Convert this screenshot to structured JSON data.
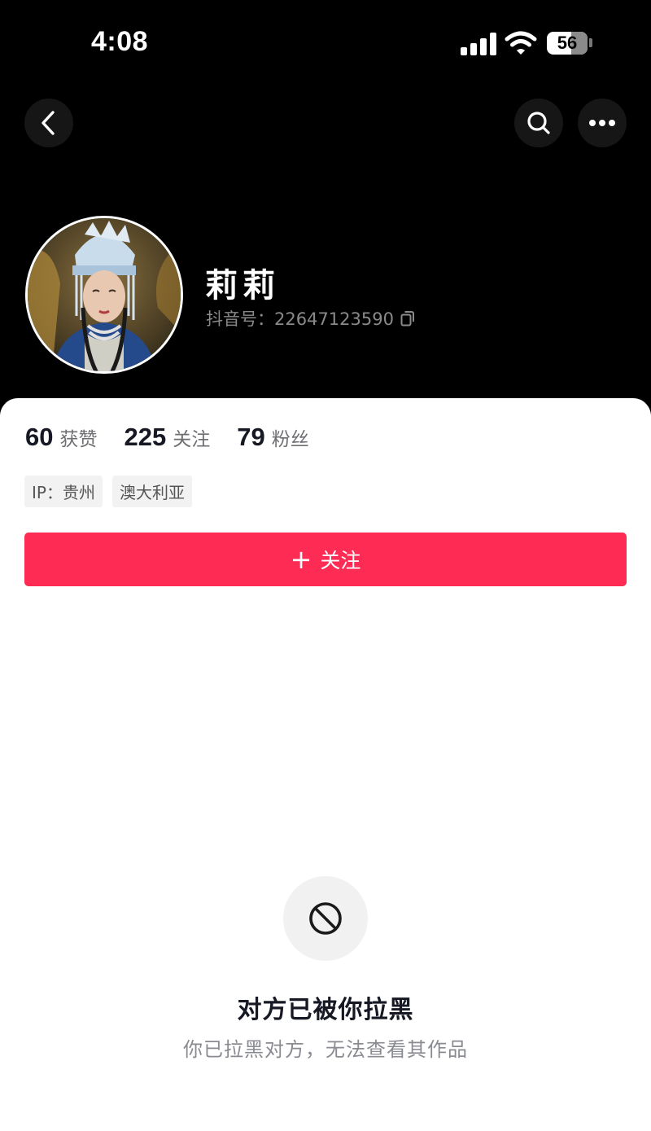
{
  "status_bar": {
    "time": "4:08",
    "battery": "56"
  },
  "header": {
    "back_icon": "chevron-left-icon",
    "search_icon": "search-icon",
    "more_icon": "more-horizontal-icon"
  },
  "profile": {
    "name": "莉莉",
    "douyin_id": "抖音号：22647123590",
    "copy_icon": "copy-icon"
  },
  "stats": [
    {
      "value": "60",
      "label": "获赞"
    },
    {
      "value": "225",
      "label": "关注"
    },
    {
      "value": "79",
      "label": "粉丝"
    }
  ],
  "tags": [
    "IP：贵州",
    "澳大利亚"
  ],
  "follow_button": {
    "icon": "+",
    "label": "关注"
  },
  "blocked": {
    "icon": "block-icon",
    "title": "对方已被你拉黑",
    "subtitle": "你已拉黑对方，无法查看其作品"
  },
  "colors": {
    "accent": "#fe2c55",
    "background": "#000000",
    "card": "#ffffff"
  }
}
